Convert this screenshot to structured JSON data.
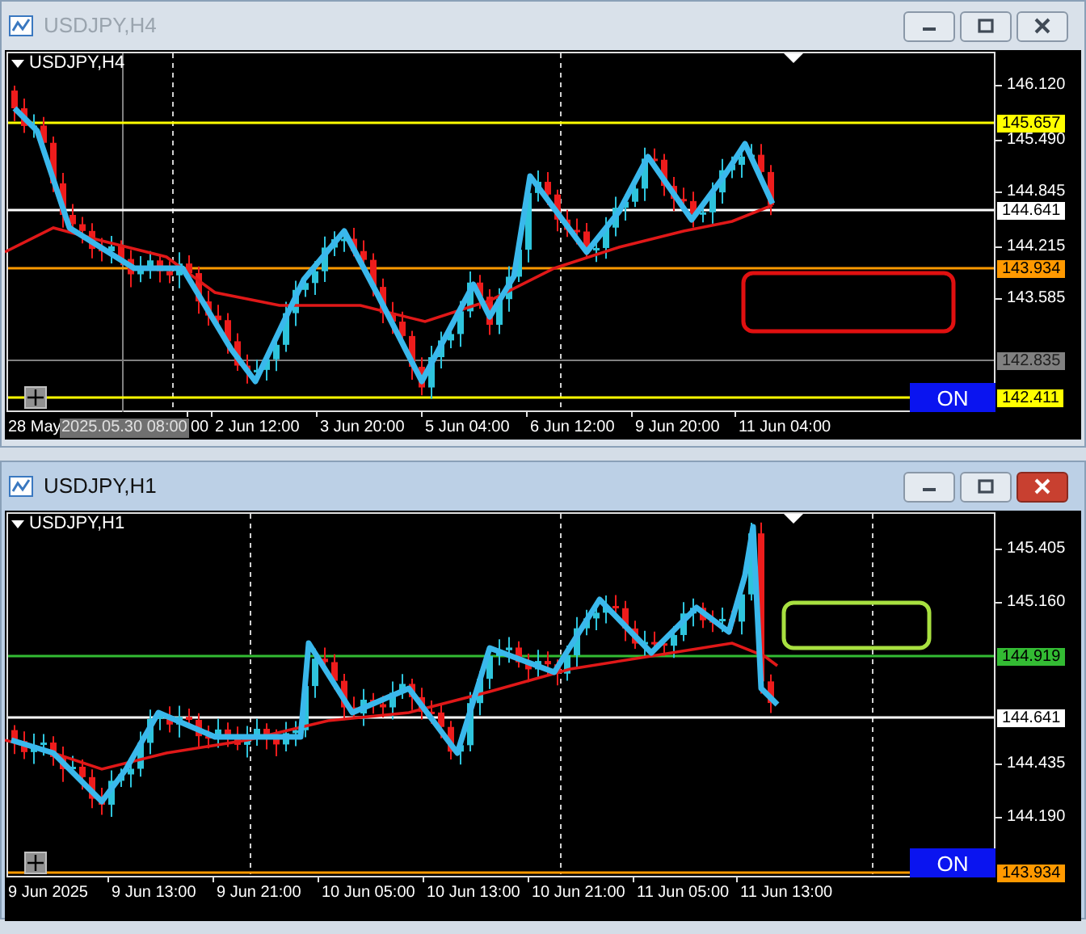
{
  "windows": [
    {
      "title": "USDJPY,H4",
      "active": false,
      "symbol_label": "USDJPY,H4",
      "button": "ON",
      "rectangle": {
        "color": "#e01010"
      },
      "price_ticks": [
        "146.120",
        "145.490",
        "144.845",
        "144.215",
        "143.585"
      ],
      "price_lines": [
        {
          "label": "145.657",
          "color": "#ffff00"
        },
        {
          "label": "144.641",
          "color": "#ffffff"
        },
        {
          "label": "143.934",
          "color": "#ff9900"
        },
        {
          "label": "142.835",
          "color": "#808080"
        },
        {
          "label": "142.411",
          "color": "#ffff00"
        }
      ],
      "time_labels": [
        "28 May",
        "00",
        "2 Jun 12:00",
        "3 Jun 20:00",
        "5 Jun 04:00",
        "6 Jun 12:00",
        "9 Jun 20:00",
        "11 Jun 04:00"
      ],
      "crosshair_label": "2025.05.30 08:00"
    },
    {
      "title": "USDJPY,H1",
      "active": true,
      "symbol_label": "USDJPY,H1",
      "button": "ON",
      "rectangle": {
        "color": "#a8e040"
      },
      "price_ticks": [
        "145.405",
        "145.160",
        "144.435",
        "144.190"
      ],
      "price_lines": [
        {
          "label": "144.919",
          "color": "#33bb33"
        },
        {
          "label": "144.641",
          "color": "#ffffff"
        },
        {
          "label": "143.934",
          "color": "#ff9900"
        }
      ],
      "time_labels": [
        "9 Jun 2025",
        "9 Jun 13:00",
        "9 Jun 21:00",
        "10 Jun 05:00",
        "10 Jun 13:00",
        "10 Jun 21:00",
        "11 Jun 05:00",
        "11 Jun 13:00"
      ]
    }
  ]
}
